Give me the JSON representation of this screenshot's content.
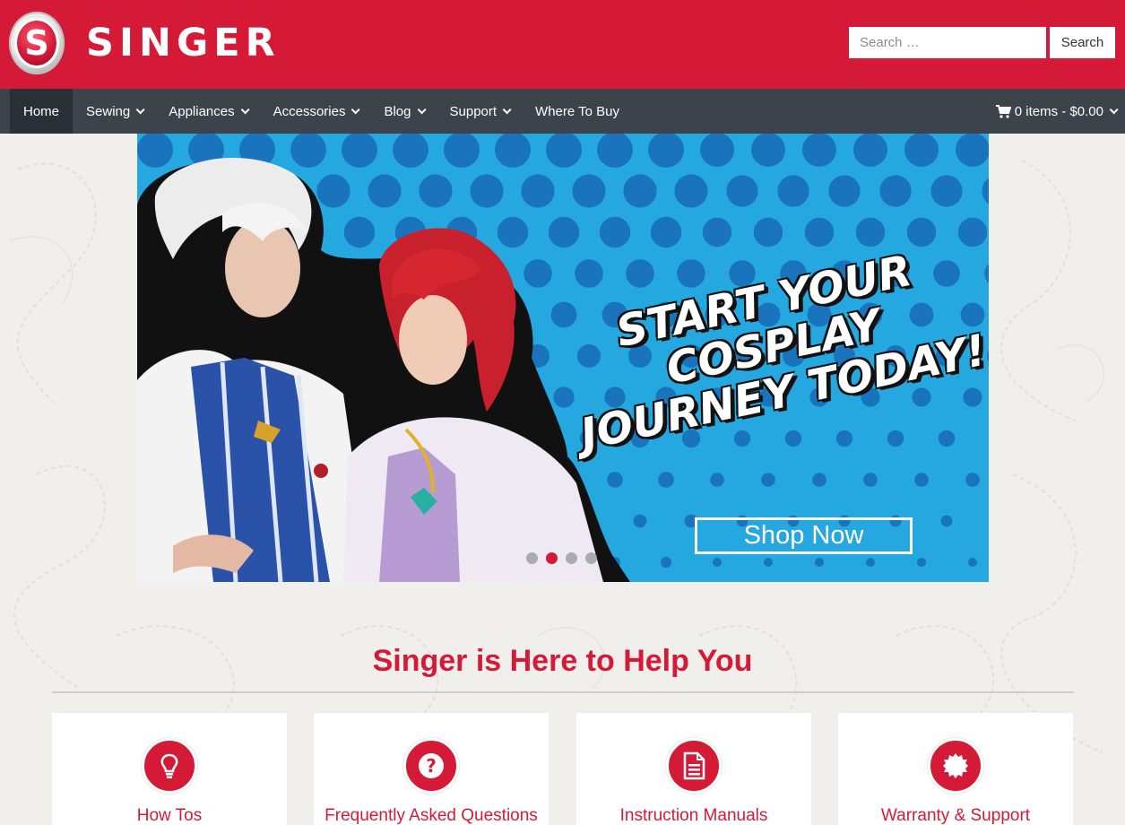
{
  "header": {
    "logo_letter": "S",
    "brand": "SINGER",
    "brand_color": "#d51a38",
    "search": {
      "placeholder": "Search …",
      "value": "",
      "button_label": "Search"
    }
  },
  "nav": {
    "items": [
      {
        "label": "Home",
        "active": true,
        "dropdown": false
      },
      {
        "label": "Sewing",
        "dropdown": true
      },
      {
        "label": "Appliances",
        "dropdown": true
      },
      {
        "label": "Accessories",
        "dropdown": true
      },
      {
        "label": "Blog",
        "dropdown": true
      },
      {
        "label": "Support",
        "dropdown": true
      },
      {
        "label": "Where To Buy",
        "dropdown": false
      }
    ],
    "cart_label": "0 items - $0.00",
    "cart_icon": "shopping-cart-icon"
  },
  "hero": {
    "headline": "START YOUR COSPLAY JOURNEY TODAY!",
    "cta_label": "Shop Now",
    "slides_total": 4,
    "active_slide_index": 1,
    "background_color": "#25a7df"
  },
  "help": {
    "heading": "Singer is Here to Help You",
    "cards": [
      {
        "label": "How Tos",
        "icon": "lightbulb-icon"
      },
      {
        "label": "Frequently Asked Questions",
        "icon": "question-icon"
      },
      {
        "label": "Instruction Manuals",
        "icon": "document-icon"
      },
      {
        "label": "Warranty & Support",
        "icon": "badge-icon"
      }
    ]
  }
}
